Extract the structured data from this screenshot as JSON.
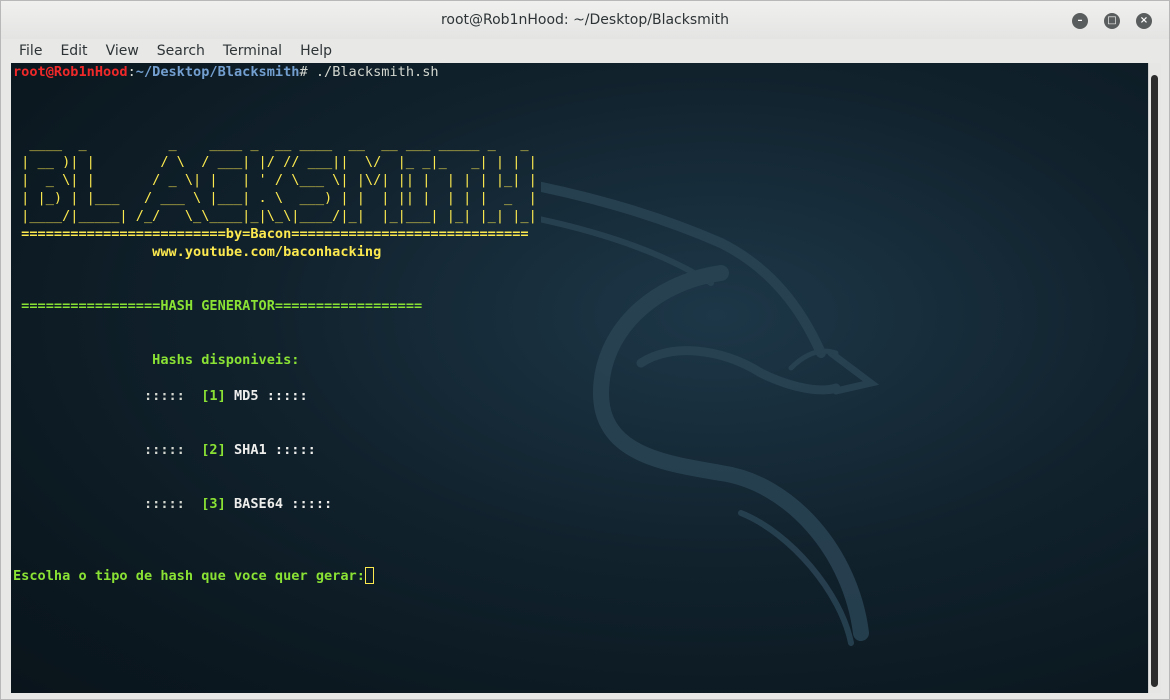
{
  "window": {
    "title": "root@Rob1nHood: ~/Desktop/Blacksmith",
    "controls": {
      "minimize": "–",
      "maximize": "□",
      "close": "×"
    }
  },
  "menubar": {
    "items": [
      "File",
      "Edit",
      "View",
      "Search",
      "Terminal",
      "Help"
    ]
  },
  "terminal": {
    "prompt_user": "root@Rob1nHood",
    "prompt_sep": ":",
    "prompt_path": "~/Desktop/Blacksmith",
    "prompt_symbol": "#",
    "command": " ./Blacksmith.sh",
    "banner": [
      "  ____  _          _    ____ _  __ ____  __  __ ___ _____ _   _ ",
      " | __ )| |        / \\  / ___| |/ // ___||  \\/  |_ _|_   _| | | |",
      " |  _ \\| |       / _ \\| |   | ' / \\___ \\| |\\/| || |  | | | |_| |",
      " | |_) | |___   / ___ \\ |___| . \\  ___) | |  | || |  | | |  _  |",
      " |____/|_____| /_/   \\_\\____|_|\\_\\|____/|_|  |_|___| |_| |_| |_|"
    ],
    "byline": " =========================by=Bacon=============================",
    "url": "                 www.youtube.com/baconhacking",
    "section_header": " =================HASH GENERATOR==================",
    "available_label": "                 Hashs disponiveis:",
    "options": [
      {
        "prefix": "                :::::  ",
        "num": "[1]",
        "name": " MD5 :::::"
      },
      {
        "prefix": "                :::::  ",
        "num": "[2]",
        "name": " SHA1 :::::"
      },
      {
        "prefix": "                :::::  ",
        "num": "[3]",
        "name": " BASE64 :::::"
      }
    ],
    "input_prompt": "Escolha o tipo de hash que voce quer gerar:"
  },
  "colors": {
    "prompt_user": "#ef2929",
    "prompt_path": "#729fcf",
    "banner": "#fce94f",
    "green_text": "#8ae234"
  }
}
